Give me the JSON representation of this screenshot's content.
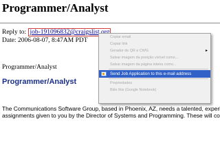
{
  "page": {
    "title": "Programmer/Analyst",
    "reply_label": "Reply to:",
    "reply_email": "job-191096832@craigslist.org",
    "date_line": "Date: 2006-08-07, 8:47AM PDT",
    "job_plain": "Programmer/Analyst",
    "job_heading": "Programmer/Analyst",
    "body_line_1": "The Communications Software Group, based in Phoenix, AZ, needs a talented, experien",
    "body_line_2": "assignments given to you by the Director of Systems and Programming. These will cons"
  },
  "context_menu": {
    "items": [
      {
        "label": "Copiar email"
      },
      {
        "label": "Copiar link"
      },
      {
        "label": "Gerador de QR e CWG"
      },
      {
        "label": "Salvar imagem da posição visível como..."
      },
      {
        "label": "Salvar imagem da página inteira como..."
      }
    ],
    "active_item": {
      "label": "Send Job Application to this e-mail address"
    },
    "bottom_items": [
      {
        "label": "Propriedades"
      },
      {
        "label": "Bkle this (Google Notebook)"
      }
    ],
    "icons": {
      "submenu": "chevron-right-icon",
      "app": "application-icon"
    }
  },
  "colors": {
    "link": "#000099",
    "heading_blue": "#1a2f8a",
    "menu_highlight": "#3161c6",
    "focus_border": "#d04040"
  }
}
